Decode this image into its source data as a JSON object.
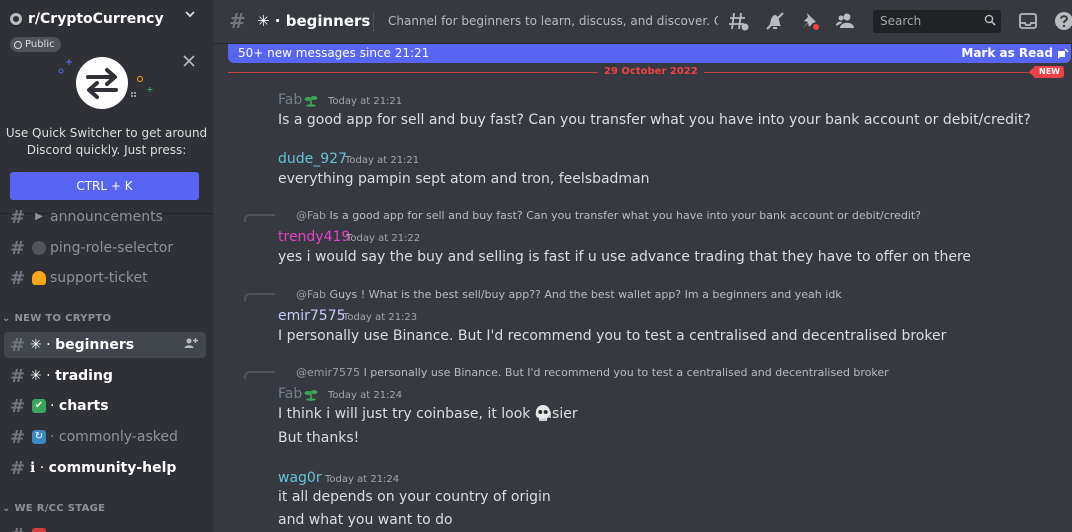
{
  "server": {
    "name": "r/CryptoCurrency",
    "badge": "Public"
  },
  "quick_switcher": {
    "text_line1": "Use Quick Switcher to get around",
    "text_line2": "Discord quickly. Just press:",
    "shortcut": "CTRL + K"
  },
  "sidebar": {
    "channels_top": [
      {
        "name": "announcements",
        "icon": "megaphone-icon"
      },
      {
        "name": "ping-role-selector",
        "icon": "robot-icon"
      },
      {
        "name": "support-ticket",
        "icon": "bell-icon"
      }
    ],
    "category_new": "NEW TO CRYPTO",
    "channels_new": [
      {
        "name": "beginners",
        "prefix": "✳ · ",
        "active": true
      },
      {
        "name": "trading",
        "prefix": "✳ · ",
        "active": false
      },
      {
        "name": "charts",
        "prefix": " · ",
        "icon": "check-box-icon"
      },
      {
        "name": "commonly-asked",
        "prefix": " · ",
        "icon": "refresh-icon"
      },
      {
        "name": "community-help",
        "prefix": "ℹ · "
      }
    ],
    "category_stage": "WE R/CC STAGE"
  },
  "header": {
    "channel_name": "✳ · beginners",
    "topic": "Channel for beginners to learn, discuss, and discover. Off top...",
    "search_placeholder": "Search"
  },
  "new_messages_bar": {
    "text": "50+ new messages since 21:21",
    "action": "Mark as Read"
  },
  "date_divider": {
    "date": "29 October 2022",
    "new_label": "NEW"
  },
  "messages": [
    {
      "author": "Fab",
      "author_color": "#747f8d",
      "time": "Today at 21:21",
      "lines": [
        "Is a good app for sell and buy fast? Can you transfer what you have into your bank account or debit/credit?"
      ]
    },
    {
      "author": "dude_927",
      "author_color": "#62c4d8",
      "time": "Today at 21:21",
      "lines": [
        "everything pampin sept atom and tron, feelsbadman"
      ]
    },
    {
      "reply_mention": "@Fab",
      "reply_text": "Is a good app for sell and buy fast? Can you transfer what you have into your bank account or debit/credit?",
      "author": "trendy419",
      "author_color": "#e640c8",
      "time": "Today at 21:22",
      "lines": [
        "yes i would say the buy and selling is fast if u use advance trading that they have to offer on there"
      ]
    },
    {
      "reply_mention": "@Fab",
      "reply_text": "Guys ! What is the best sell/buy app?? And the best wallet app? Im a beginners and yeah idk",
      "author": "emir7575",
      "author_color": "#c9cdfb",
      "time": "Today at 21:23",
      "lines": [
        "I personally use Binance. But I'd  recommend you to test a centralised and decentralised broker"
      ]
    },
    {
      "reply_mention": "@emir7575",
      "reply_text": "I personally use Binance. But I'd  recommend you to test a centralised and decentralised broker",
      "author": "Fab",
      "author_color": "#747f8d",
      "time": "Today at 21:24",
      "lines": [
        "I think i will just try coinbase, it look easier",
        "But thanks!"
      ]
    },
    {
      "author": "wag0r",
      "author_color": "#62c4d8",
      "time": "Today at 21:24",
      "lines": [
        "it all depends on your country of origin",
        "and what you want to do"
      ]
    }
  ]
}
